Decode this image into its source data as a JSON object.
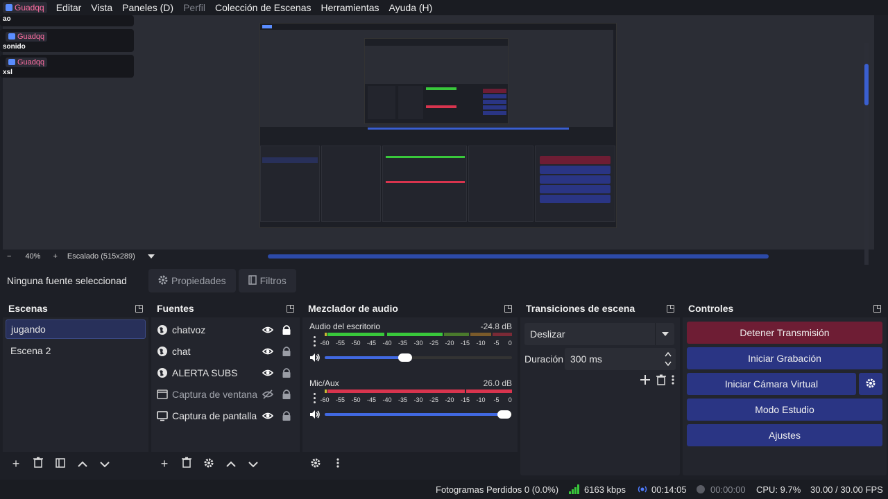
{
  "menubar": {
    "badge_user": "Guadqq",
    "items": [
      {
        "label": "Editar",
        "disabled": false
      },
      {
        "label": "Vista",
        "disabled": false
      },
      {
        "label": "Paneles (D)",
        "disabled": false
      },
      {
        "label": "Perfil",
        "disabled": true
      },
      {
        "label": "Colección de Escenas",
        "disabled": false
      },
      {
        "label": "Herramientas",
        "disabled": false
      },
      {
        "label": "Ayuda (H)",
        "disabled": false
      }
    ]
  },
  "chat": {
    "messages": [
      {
        "user": "",
        "text": "ao"
      },
      {
        "user": "Guadqq",
        "text": "sonido"
      },
      {
        "user": "Guadqq",
        "text": "xsl"
      }
    ]
  },
  "zoom": {
    "minus": "−",
    "level": "40%",
    "plus": "+",
    "scale": "Escalado (515x289)"
  },
  "properties": {
    "no_selection": "Ninguna fuente seleccionad",
    "properties_label": "Propiedades",
    "filters_label": "Filtros"
  },
  "scenes": {
    "title": "Escenas",
    "items": [
      "jugando",
      "Escena 2"
    ]
  },
  "sources": {
    "title": "Fuentes",
    "items": [
      {
        "label": "chatvoz",
        "icon": "globe-icon",
        "visible": true,
        "locked": true
      },
      {
        "label": "chat",
        "icon": "globe-icon",
        "visible": true,
        "locked": false
      },
      {
        "label": "ALERTA SUBS",
        "icon": "globe-icon",
        "visible": true,
        "locked": false
      },
      {
        "label": "Captura de ventana",
        "icon": "window-icon",
        "visible": false,
        "locked": false
      },
      {
        "label": "Captura de pantalla",
        "icon": "monitor-icon",
        "visible": true,
        "locked": false
      }
    ]
  },
  "mixer": {
    "title": "Mezclador de audio",
    "channels": [
      {
        "name": "Audio del escritorio",
        "db": "-24.8 dB",
        "volume": 0.43
      },
      {
        "name": "Mic/Aux",
        "db": "26.0 dB",
        "volume": 0.96
      }
    ],
    "ticks": [
      "-60",
      "-55",
      "-50",
      "-45",
      "-40",
      "-35",
      "-30",
      "-25",
      "-20",
      "-15",
      "-10",
      "-5",
      "0"
    ]
  },
  "transitions": {
    "title": "Transiciones de escena",
    "selected": "Deslizar",
    "duration_label": "Duración",
    "duration_value": "300 ms"
  },
  "controls": {
    "title": "Controles",
    "stop_stream": "Detener Transmisión",
    "start_recording": "Iniciar Grabación",
    "start_virtual_cam": "Iniciar Cámara Virtual",
    "studio_mode": "Modo Estudio",
    "settings": "Ajustes"
  },
  "status": {
    "dropped": "Fotogramas Perdidos 0 (0.0%)",
    "bitrate": "6163 kbps",
    "stream_time": "00:14:05",
    "rec_time": "00:00:00",
    "cpu": "CPU: 9.7%",
    "fps": "30.00 / 30.00 FPS"
  },
  "colors": {
    "accent": "#2a3584",
    "stop": "#6e1d34",
    "meter_green": "#39c83b",
    "meter_red": "#d8344e",
    "meter_yellow": "#c9b834"
  }
}
